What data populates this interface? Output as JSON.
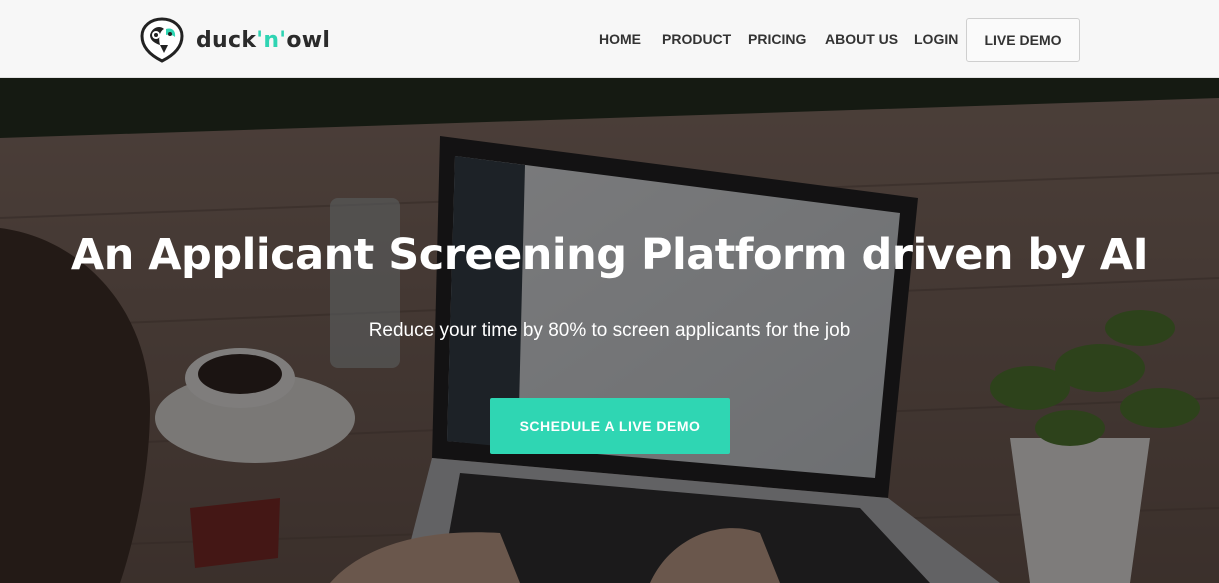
{
  "brand": {
    "name_prefix": "duck",
    "name_accent": "'n'",
    "name_suffix": "owl",
    "accent_color": "#2fd6b3"
  },
  "nav": {
    "items": [
      {
        "label": "HOME"
      },
      {
        "label": "PRODUCT"
      },
      {
        "label": "PRICING"
      },
      {
        "label": "ABOUT US"
      },
      {
        "label": "LOGIN"
      }
    ],
    "demo_button": "LIVE DEMO"
  },
  "hero": {
    "title": "An Applicant Screening Platform driven by AI",
    "subtitle": "Reduce your time by 80% to screen applicants for the job",
    "cta_label": "SCHEDULE A LIVE DEMO",
    "background": "laptop-on-wooden-table-photo"
  }
}
